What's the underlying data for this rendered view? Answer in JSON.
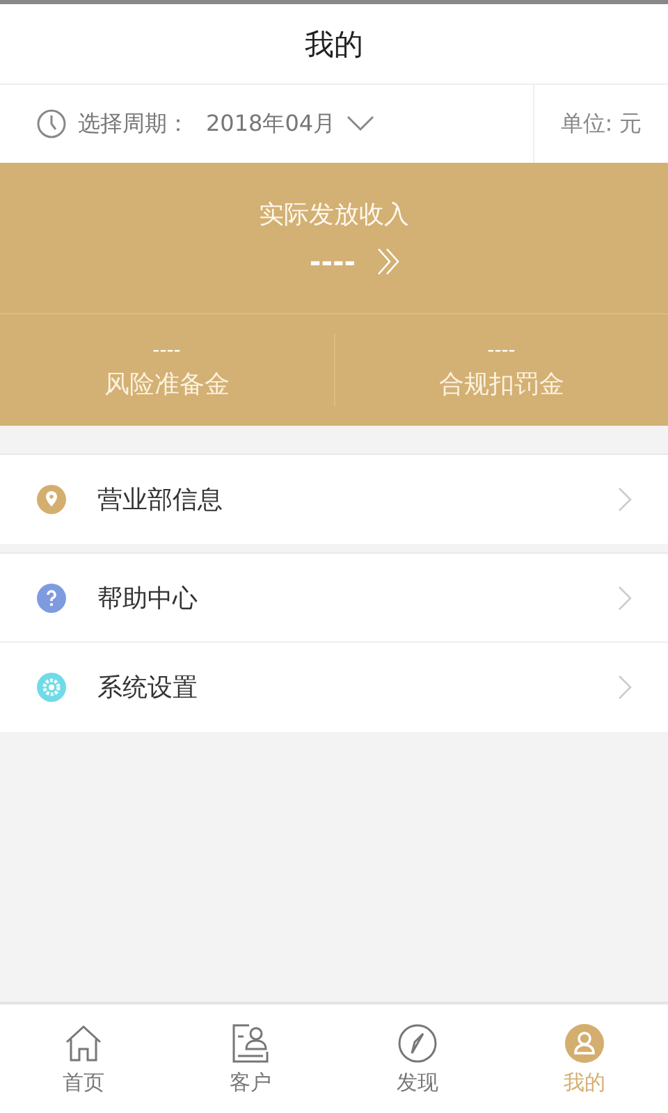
{
  "header": {
    "title": "我的"
  },
  "period": {
    "label": "选择周期：",
    "value": "2018年04月",
    "unit": "单位: 元"
  },
  "summary": {
    "title": "实际发放收入",
    "value": "----",
    "stats": [
      {
        "value": "----",
        "label": "风险准备金"
      },
      {
        "value": "----",
        "label": "合规扣罚金"
      }
    ]
  },
  "menu_groups": [
    [
      {
        "kind": "location",
        "color": "#d4ae6e",
        "label": "营业部信息"
      }
    ],
    [
      {
        "kind": "help",
        "color": "#7f9be0",
        "label": "帮助中心"
      },
      {
        "kind": "settings",
        "color": "#6fdbe8",
        "label": "系统设置"
      }
    ]
  ],
  "tab_bar": [
    {
      "kind": "home",
      "label": "首页",
      "selected": false
    },
    {
      "kind": "customer",
      "label": "客户",
      "selected": false
    },
    {
      "kind": "discover",
      "label": "发现",
      "selected": false
    },
    {
      "kind": "profile",
      "label": "我的",
      "selected": true
    }
  ]
}
